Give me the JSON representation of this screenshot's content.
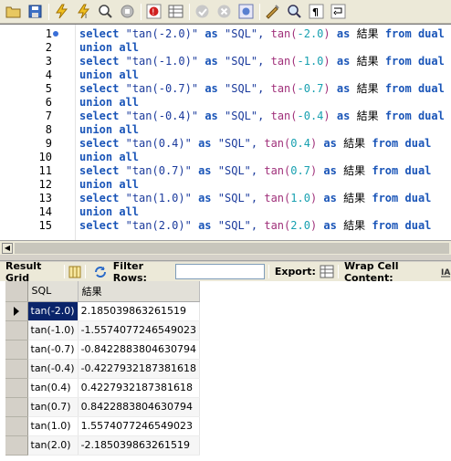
{
  "toolbar": {
    "icons": [
      "open-file-icon",
      "save-icon",
      "execute-icon",
      "execute-current-icon",
      "explain-icon",
      "stop-icon",
      "toggle-error-icon",
      "toggle-grid-icon",
      "commit-icon",
      "rollback-icon",
      "autocommit-icon",
      "beautify-icon",
      "find-icon",
      "invisible-chars-icon",
      "wrap-icon"
    ]
  },
  "editor": {
    "lines": [
      {
        "n": "1",
        "type": "select",
        "s": "\"tan(-2.0)\"",
        "fn": "tan(",
        "arg": "-2.0"
      },
      {
        "n": "2",
        "type": "union"
      },
      {
        "n": "3",
        "type": "select",
        "s": "\"tan(-1.0)\"",
        "fn": "tan(",
        "arg": "-1.0"
      },
      {
        "n": "4",
        "type": "union"
      },
      {
        "n": "5",
        "type": "select",
        "s": "\"tan(-0.7)\"",
        "fn": "tan(",
        "arg": "-0.7"
      },
      {
        "n": "6",
        "type": "union"
      },
      {
        "n": "7",
        "type": "select",
        "s": "\"tan(-0.4)\"",
        "fn": "tan(",
        "arg": "-0.4"
      },
      {
        "n": "8",
        "type": "union"
      },
      {
        "n": "9",
        "type": "select",
        "s": "\"tan(0.4)\"",
        "fn": "tan(",
        "arg": "0.4"
      },
      {
        "n": "10",
        "type": "union"
      },
      {
        "n": "11",
        "type": "select",
        "s": "\"tan(0.7)\"",
        "fn": "tan(",
        "arg": "0.7"
      },
      {
        "n": "12",
        "type": "union"
      },
      {
        "n": "13",
        "type": "select",
        "s": "\"tan(1.0)\"",
        "fn": "tan(",
        "arg": "1.0"
      },
      {
        "n": "14",
        "type": "union"
      },
      {
        "n": "15",
        "type": "select",
        "s": "\"tan(2.0)\"",
        "fn": "tan(",
        "arg": "2.0"
      }
    ],
    "kw_select": "select",
    "kw_as": "as",
    "alias_sql": "\"SQL\",",
    "comma": ",",
    "close_paren": ")",
    "alias_result": "結果",
    "kw_from": "from",
    "kw_dual": "dual",
    "kw_union": "union all"
  },
  "result_toolbar": {
    "result_grid": "Result Grid",
    "filter_rows": "Filter Rows:",
    "filter_value": "",
    "export": "Export:",
    "wrap": "Wrap Cell Content:"
  },
  "grid": {
    "headers": [
      "SQL",
      "結果"
    ],
    "rows": [
      [
        "tan(-2.0)",
        "2.185039863261519"
      ],
      [
        "tan(-1.0)",
        "-1.5574077246549023"
      ],
      [
        "tan(-0.7)",
        "-0.8422883804630794"
      ],
      [
        "tan(-0.4)",
        "-0.4227932187381618"
      ],
      [
        "tan(0.4)",
        "0.4227932187381618"
      ],
      [
        "tan(0.7)",
        "0.8422883804630794"
      ],
      [
        "tan(1.0)",
        "1.5574077246549023"
      ],
      [
        "tan(2.0)",
        "-2.185039863261519"
      ]
    ],
    "selected_row": 0
  }
}
